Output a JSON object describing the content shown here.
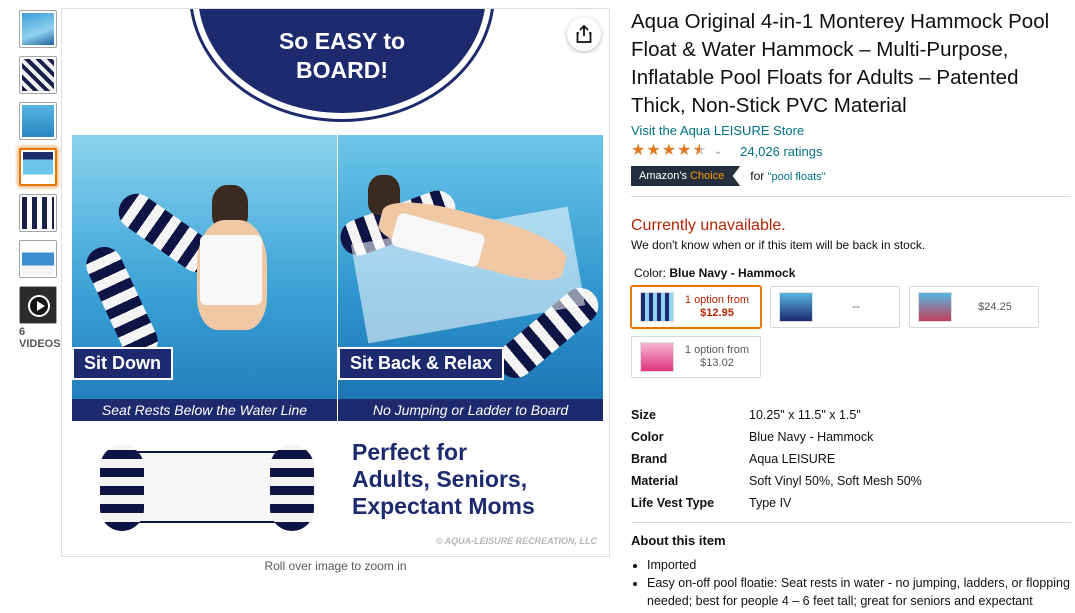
{
  "thumbnails": {
    "video_label": "6 VIDEOS"
  },
  "main_image": {
    "badge_line1": "So EASY to",
    "badge_line2": "BOARD!",
    "left_label": "Sit Down",
    "left_caption": "Seat Rests Below the Water Line",
    "right_label": "Sit Back & Relax",
    "right_caption": "No Jumping or Ladder to Board",
    "perfect_line1": "Perfect for",
    "perfect_line2": "Adults, Seniors,",
    "perfect_line3": "Expectant Moms",
    "watermark": "© AQUA-LEISURE RECREATION, LLC",
    "rollover_text": "Roll over image to zoom in"
  },
  "product": {
    "title": "Aqua Original 4-in-1 Monterey Hammock Pool Float & Water Hammock – Multi-Purpose, Inflatable Pool Floats for Adults – Patented Thick, Non-Stick PVC Material",
    "store_link": "Visit the Aqua LEISURE Store",
    "rating_value": 4.5,
    "ratings_count": "24,026 ratings",
    "choice_prefix": "Amazon's ",
    "choice_word": "Choice",
    "choice_for": "for ",
    "choice_query": "\"pool floats\"",
    "availability": "Currently unavailable.",
    "availability_note": "We don't know when or if this item will be back in stock.",
    "color_label": "Color: ",
    "color_value": "Blue Navy - Hammock"
  },
  "swatches": [
    {
      "line1": "1 option from",
      "line2": "$12.95"
    },
    {
      "line1": "-- ",
      "line2": ""
    },
    {
      "line1": "$24.25",
      "line2": ""
    },
    {
      "line1": "1 option from",
      "line2": "$13.02"
    }
  ],
  "specs": [
    {
      "key": "Size",
      "value": "10.25\" x 11.5\" x 1.5\""
    },
    {
      "key": "Color",
      "value": "Blue Navy - Hammock"
    },
    {
      "key": "Brand",
      "value": "Aqua LEISURE"
    },
    {
      "key": "Material",
      "value": "Soft Vinyl 50%, Soft Mesh 50%"
    },
    {
      "key": "Life Vest Type",
      "value": "Type IV"
    }
  ],
  "about": {
    "title": "About this item",
    "bullets": [
      "Imported",
      "Easy on-off pool floatie: Seat rests in water - no jumping, ladders, or flopping needed; best for people 4 – 6 feet tall; great for seniors and expectant mothers"
    ]
  },
  "colors": {
    "link": "#007185",
    "price_red": "#b12704",
    "star": "#de7921",
    "selected_border": "#e77600",
    "navy": "#1d2a6d"
  }
}
